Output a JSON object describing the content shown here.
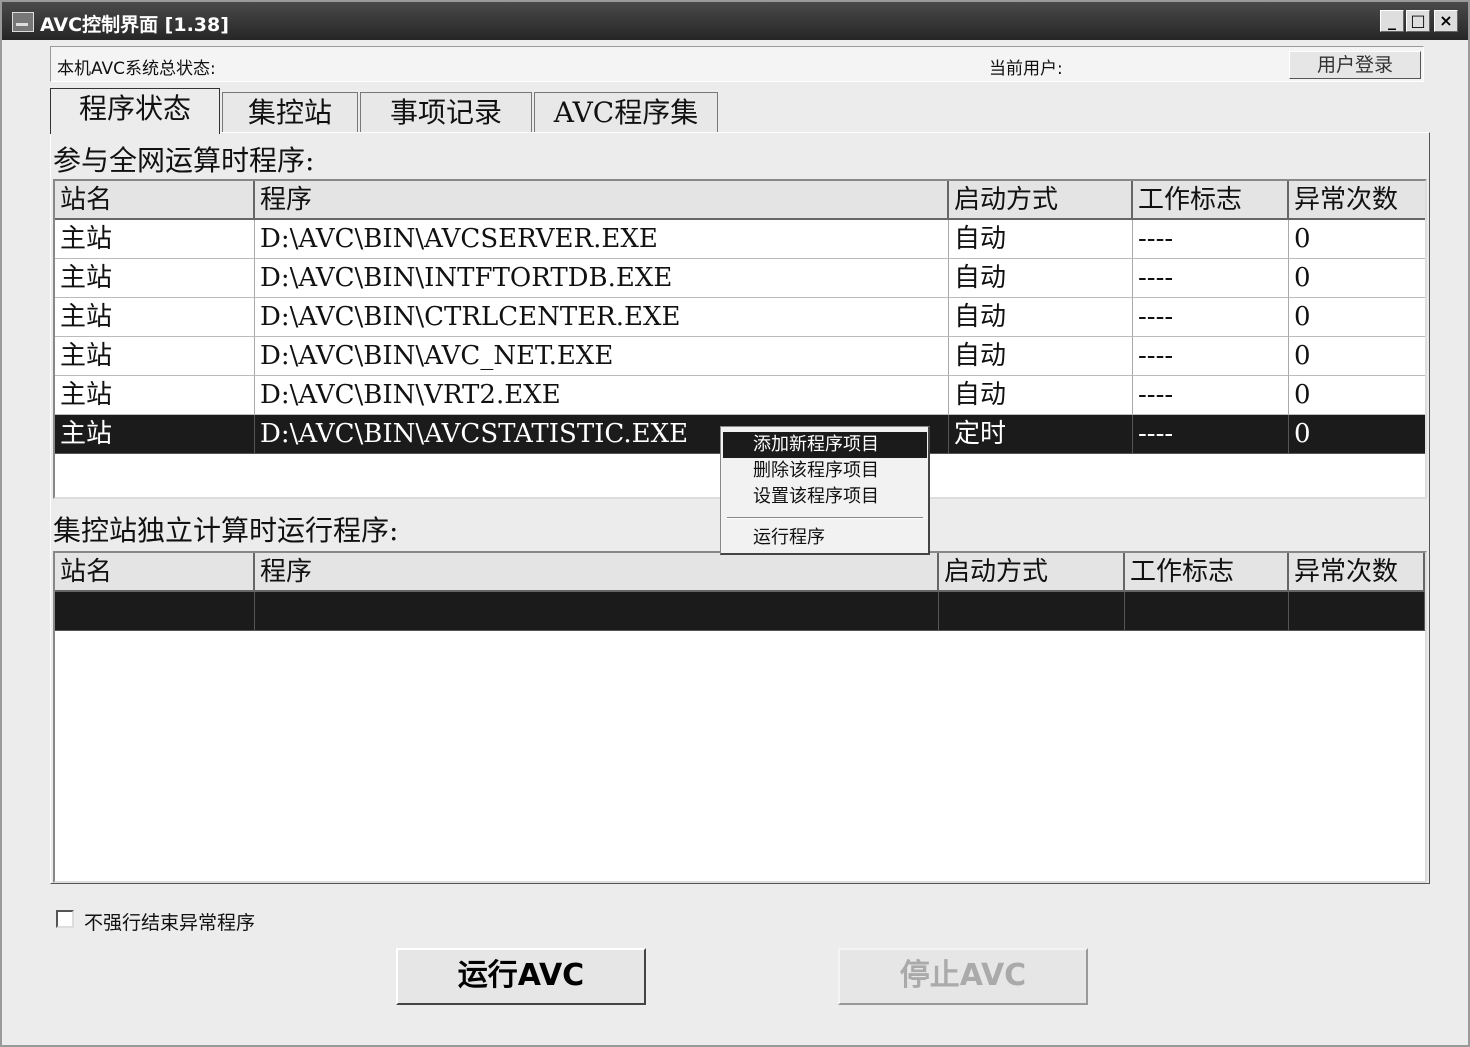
{
  "window": {
    "title": "AVC控制界面 [1.38]",
    "controls": {
      "minimize": "_",
      "maximize": "□",
      "close": "×"
    }
  },
  "status_bar": {
    "system_status_label": "本机AVC系统总状态:",
    "current_user_label": "当前用户:",
    "login_button": "用户登录"
  },
  "tabs": [
    {
      "label": "程序状态",
      "active": true
    },
    {
      "label": "集控站",
      "active": false
    },
    {
      "label": "事项记录",
      "active": false
    },
    {
      "label": "AVC程序集",
      "active": false
    }
  ],
  "network_section": {
    "title": "参与全网运算时程序:",
    "columns": [
      "站名",
      "程序",
      "启动方式",
      "工作标志",
      "异常次数"
    ],
    "rows": [
      [
        "主站",
        "D:\\AVC\\BIN\\AVCSERVER.EXE",
        "自动",
        "----",
        "0"
      ],
      [
        "主站",
        "D:\\AVC\\BIN\\INTFTORTDB.EXE",
        "自动",
        "----",
        "0"
      ],
      [
        "主站",
        "D:\\AVC\\BIN\\CTRLCENTER.EXE",
        "自动",
        "----",
        "0"
      ],
      [
        "主站",
        "D:\\AVC\\BIN\\AVC_NET.EXE",
        "自动",
        "----",
        "0"
      ],
      [
        "主站",
        "D:\\AVC\\BIN\\VRT2.EXE",
        "自动",
        "----",
        "0"
      ],
      [
        "主站",
        "D:\\AVC\\BIN\\AVCSTATISTIC.EXE",
        "定时",
        "----",
        "0"
      ]
    ],
    "selected_row": 5
  },
  "independent_section": {
    "title": "集控站独立计算时运行程序:",
    "columns": [
      "站名",
      "程序",
      "启动方式",
      "工作标志",
      "异常次数"
    ]
  },
  "context_menu": {
    "items": [
      "添加新程序项目",
      "删除该程序项目",
      "设置该程序项目",
      "运行程序"
    ],
    "highlighted": 0
  },
  "options": {
    "no_force_kill_label": "不强行结束异常程序",
    "no_force_kill_checked": false
  },
  "buttons": {
    "run_avc": "运行AVC",
    "stop_avc": "停止AVC"
  }
}
